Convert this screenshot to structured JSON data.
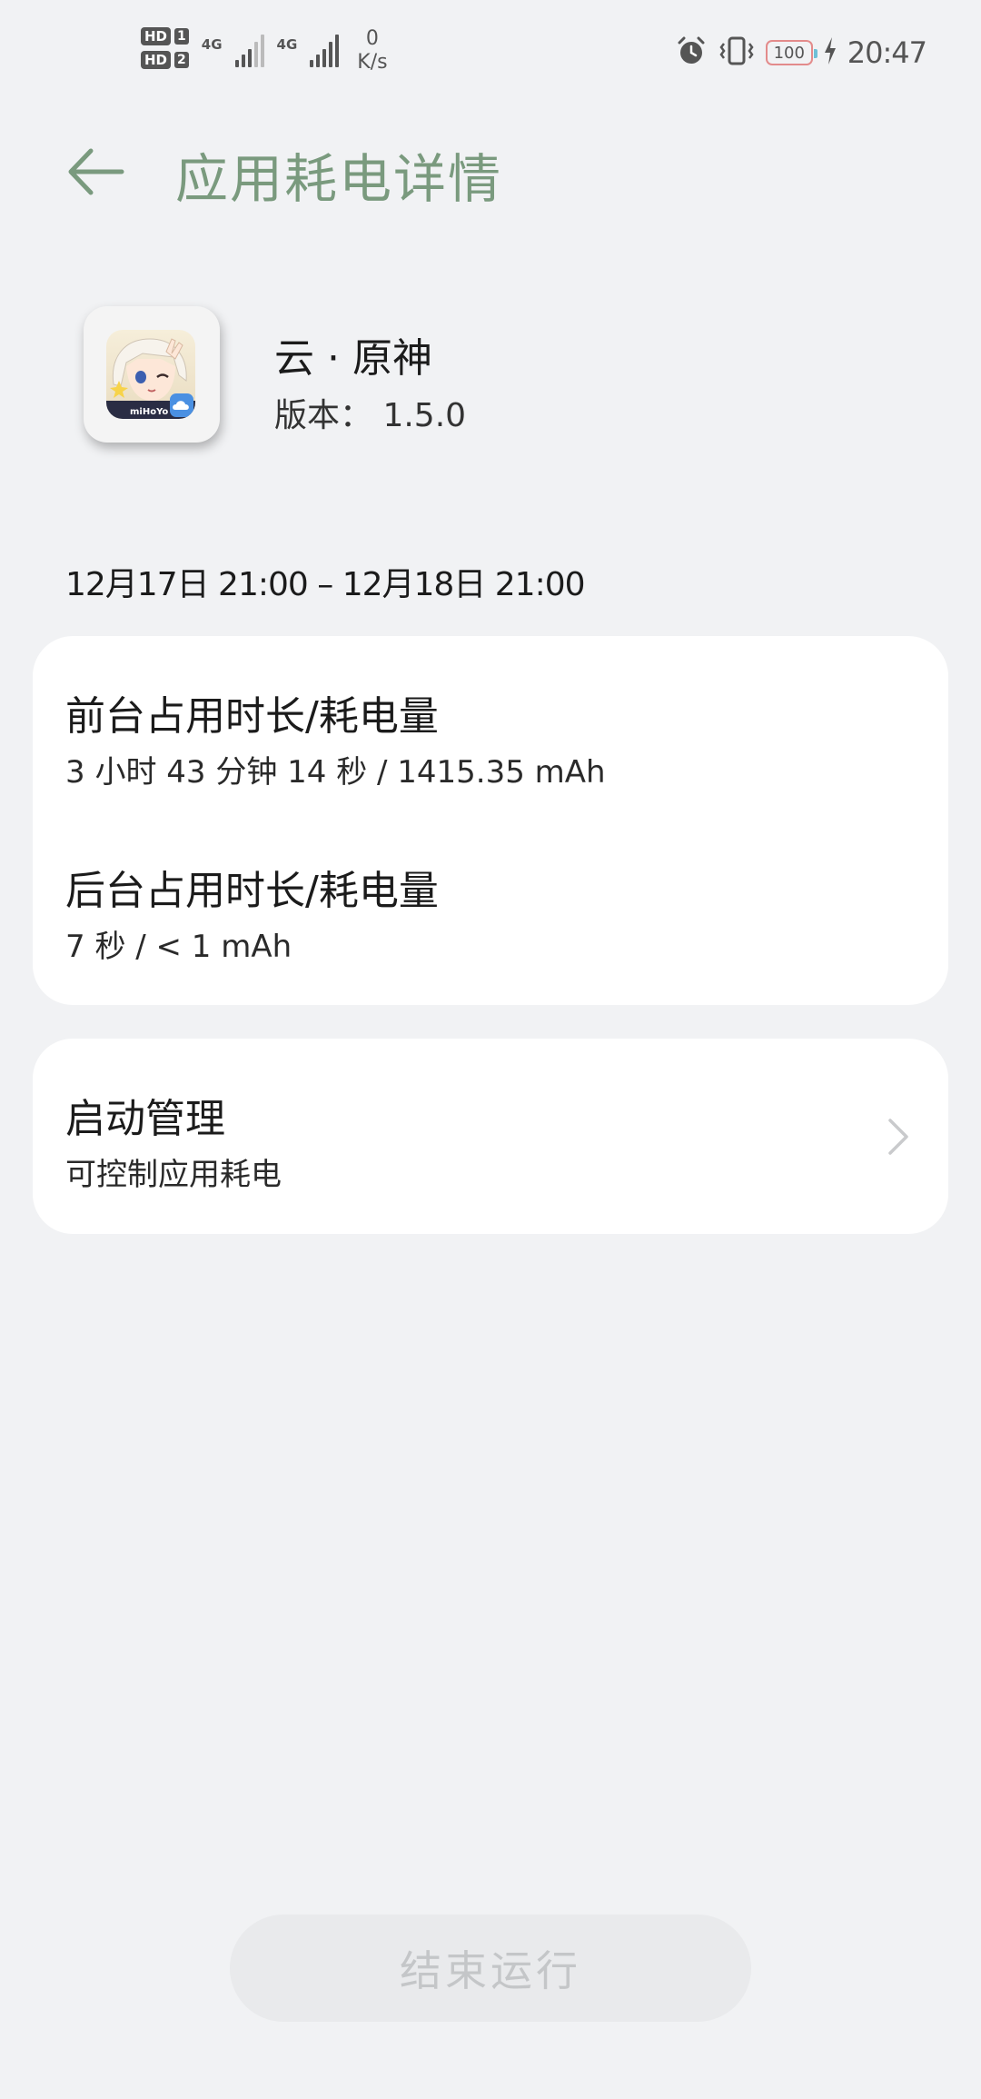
{
  "status_bar": {
    "hd1": "HD",
    "hd1_num": "1",
    "hd2": "HD",
    "hd2_num": "2",
    "net1": "4G",
    "net2": "4G",
    "speed_value": "0",
    "speed_unit": "K/s",
    "battery_level": "100",
    "time": "20:47"
  },
  "header": {
    "title": "应用耗电详情"
  },
  "app": {
    "name": "云 · 原神",
    "version": "版本： 1.5.0",
    "icon_brand": "miHoYo"
  },
  "date_range": "12月17日 21:00 – 12月18日 21:00",
  "usage": {
    "foreground_title": "前台占用时长/耗电量",
    "foreground_value": "3 小时 43 分钟 14 秒 / 1415.35 mAh",
    "background_title": "后台占用时长/耗电量",
    "background_value": "7 秒 / < 1 mAh"
  },
  "launch": {
    "title": "启动管理",
    "subtitle": "可控制应用耗电"
  },
  "end_button": "结束运行",
  "colors": {
    "background": "#f1f2f4",
    "title_green": "#7a9a7e",
    "card": "#ffffff",
    "disabled_text": "#c4c6c8"
  }
}
